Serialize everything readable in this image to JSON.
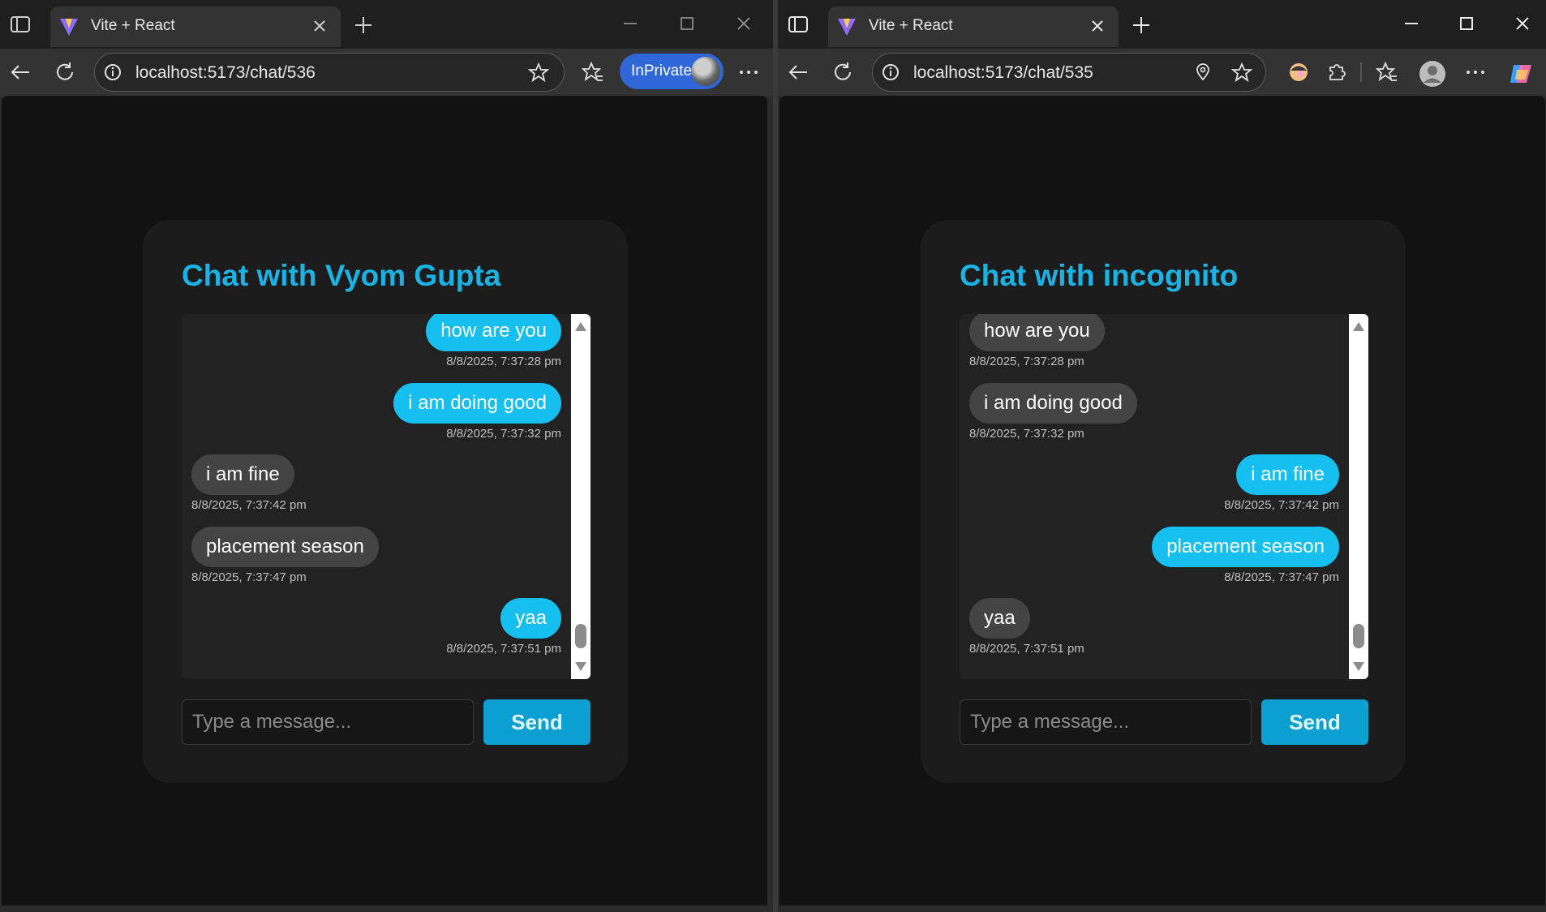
{
  "left_window": {
    "tab_title": "Vite + React",
    "url": "localhost:5173/chat/536",
    "inprivate_label": "InPrivate",
    "chat_title": "Chat with Vyom Gupta",
    "messages": [
      {
        "text": "how are you",
        "time": "8/8/2025, 7:37:28 pm",
        "side": "sent"
      },
      {
        "text": "i am doing good",
        "time": "8/8/2025, 7:37:32 pm",
        "side": "sent"
      },
      {
        "text": "i am fine",
        "time": "8/8/2025, 7:37:42 pm",
        "side": "recv"
      },
      {
        "text": "placement season",
        "time": "8/8/2025, 7:37:47 pm",
        "side": "recv"
      },
      {
        "text": "yaa",
        "time": "8/8/2025, 7:37:51 pm",
        "side": "sent"
      }
    ],
    "input_placeholder": "Type a message...",
    "send_label": "Send"
  },
  "right_window": {
    "tab_title": "Vite + React",
    "url": "localhost:5173/chat/535",
    "chat_title": "Chat with incognito",
    "messages": [
      {
        "text": "how are you",
        "time": "8/8/2025, 7:37:28 pm",
        "side": "recv"
      },
      {
        "text": "i am doing good",
        "time": "8/8/2025, 7:37:32 pm",
        "side": "recv"
      },
      {
        "text": "i am fine",
        "time": "8/8/2025, 7:37:42 pm",
        "side": "sent"
      },
      {
        "text": "placement season",
        "time": "8/8/2025, 7:37:47 pm",
        "side": "sent"
      },
      {
        "text": "yaa",
        "time": "8/8/2025, 7:37:51 pm",
        "side": "recv"
      }
    ],
    "input_placeholder": "Type a message...",
    "send_label": "Send"
  },
  "colors": {
    "accent": "#1ab3e6",
    "sent_bubble": "#15c0f0",
    "recv_bubble": "#444444",
    "send_button": "#0c9fd1",
    "inprivate_badge": "#2f67d8"
  }
}
